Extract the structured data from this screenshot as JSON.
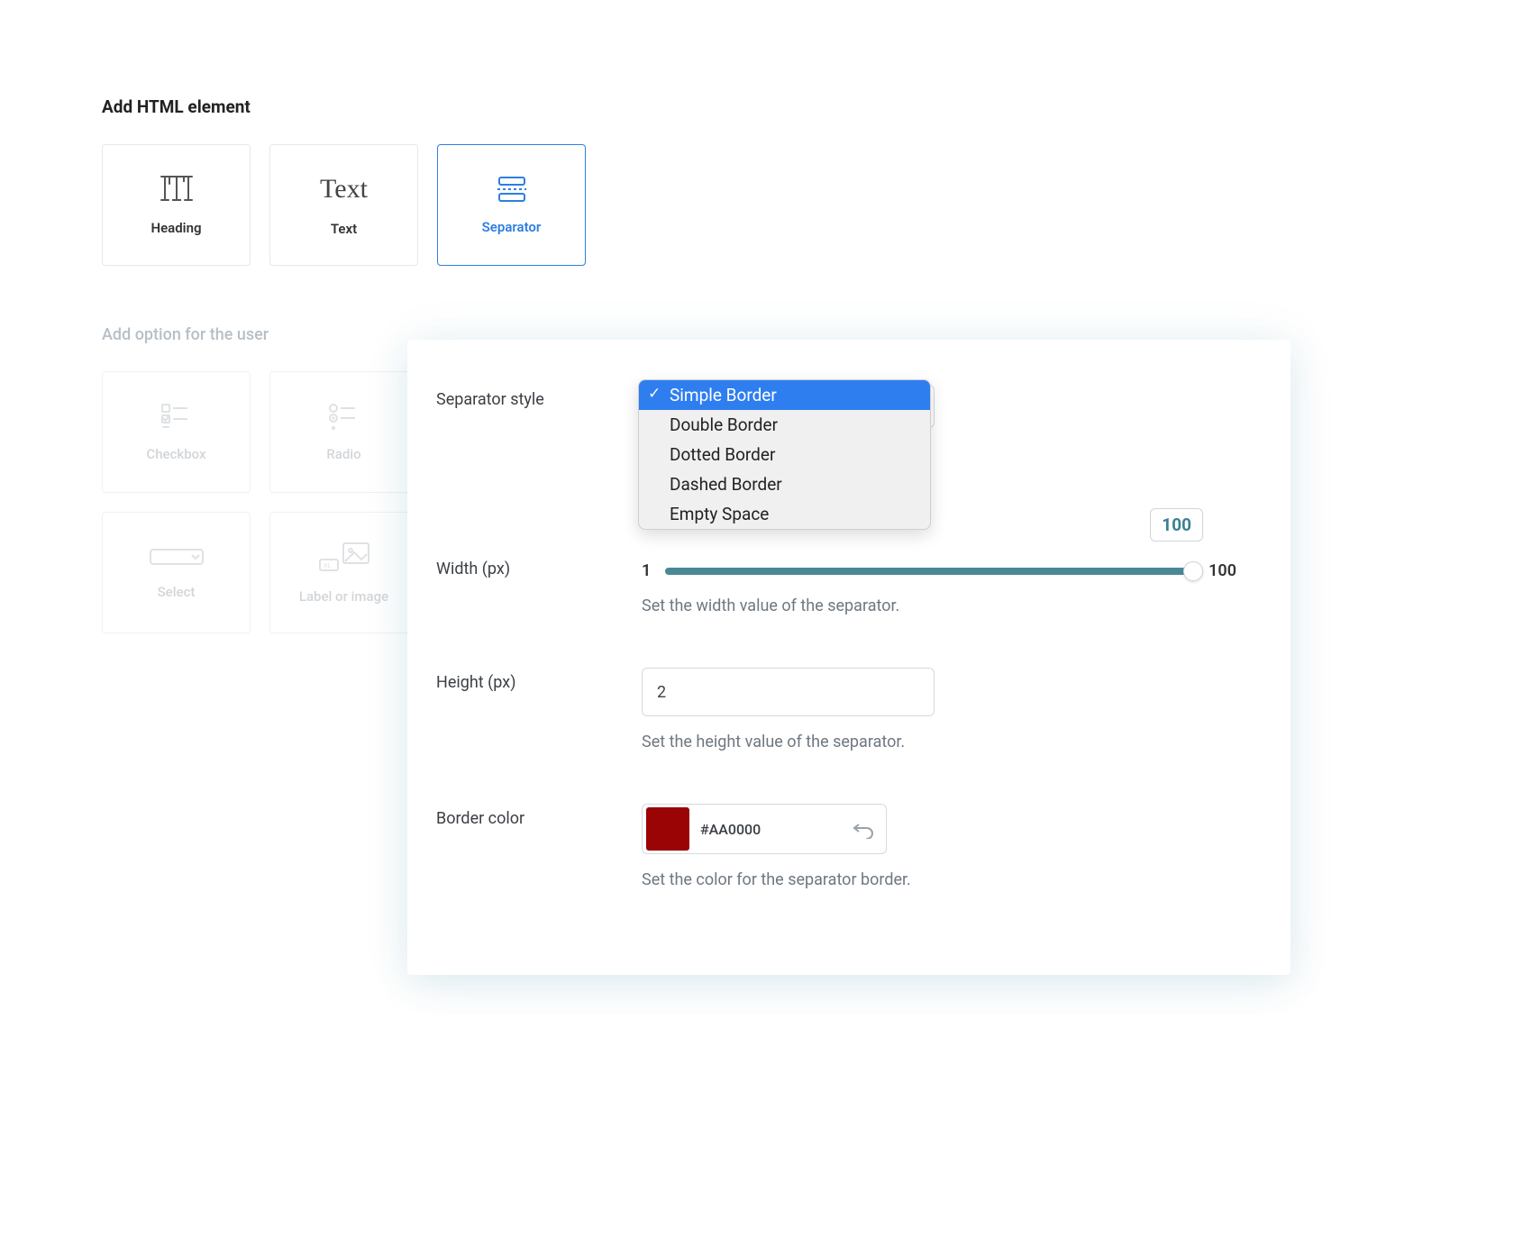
{
  "sections": {
    "html_elements_title": "Add HTML element",
    "user_options_title": "Add option for the user"
  },
  "cards": {
    "heading": "Heading",
    "text": "Text",
    "separator": "Separator",
    "checkbox": "Checkbox",
    "radio": "Radio",
    "select": "Select",
    "label_or_image": "Label or image"
  },
  "panel": {
    "separator_style": {
      "label": "Separator style",
      "options": [
        "Simple Border",
        "Double Border",
        "Dotted Border",
        "Dashed Border",
        "Empty Space"
      ],
      "selected": "Simple Border"
    },
    "width": {
      "label": "Width (px)",
      "min": "1",
      "max": "100",
      "value": "100",
      "helper": "Set the width value of the separator."
    },
    "height": {
      "label": "Height (px)",
      "value": "2",
      "helper": "Set the height value of the separator."
    },
    "border_color": {
      "label": "Border color",
      "value": "#AA0000",
      "swatch": "#9b0404",
      "helper": "Set the color for the separator border."
    }
  }
}
